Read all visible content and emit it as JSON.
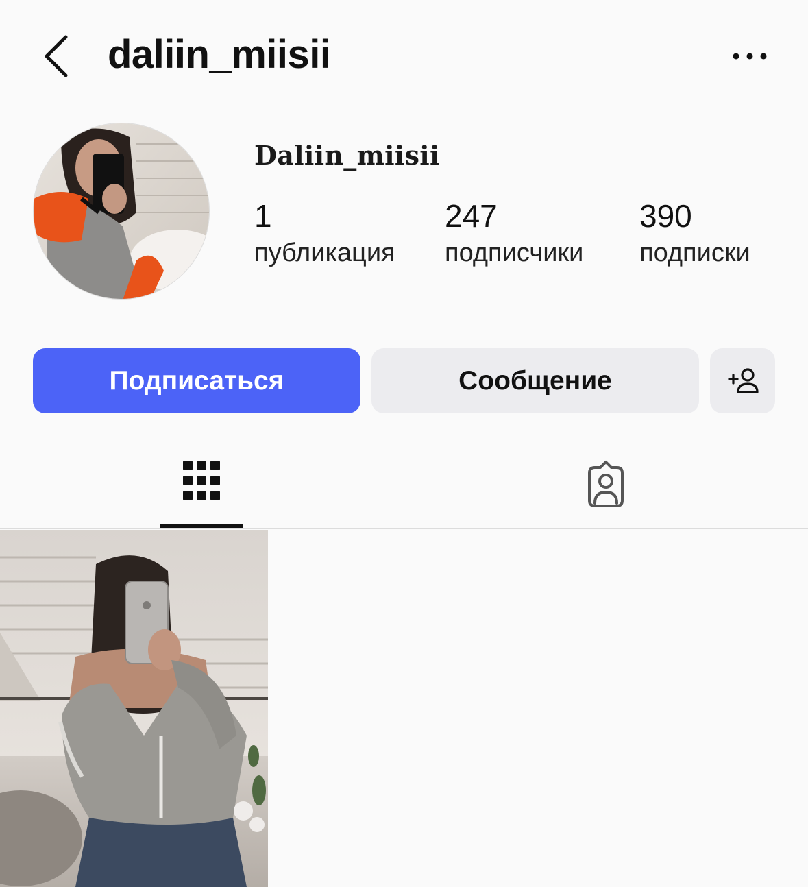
{
  "header": {
    "username": "daliin_miisii",
    "back_icon": "chevron-left-icon",
    "more_icon": "more-horizontal-icon"
  },
  "profile": {
    "display_name": "Daliin_miisii",
    "stats": {
      "posts": {
        "count": "1",
        "label": "публикация"
      },
      "followers": {
        "count": "247",
        "label": "подписчики"
      },
      "following": {
        "count": "390",
        "label": "подписки"
      }
    }
  },
  "actions": {
    "follow_label": "Подписаться",
    "message_label": "Сообщение",
    "add_user_icon": "add-person-icon"
  },
  "tabs": [
    {
      "name": "posts-grid",
      "icon": "grid-icon",
      "active": true
    },
    {
      "name": "tagged",
      "icon": "tagged-person-icon",
      "active": false
    }
  ],
  "colors": {
    "accent": "#4c63f7",
    "secondary_button": "#ececef",
    "background": "#fafafa"
  }
}
